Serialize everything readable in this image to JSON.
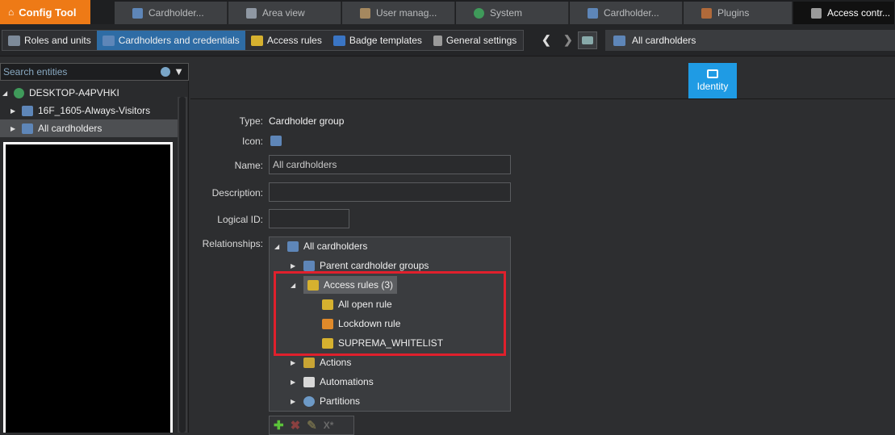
{
  "app": {
    "title": "Config Tool"
  },
  "tabs": [
    {
      "label": "Cardholder...",
      "icon": "cardholder-icon"
    },
    {
      "label": "Area view",
      "icon": "area-view-icon"
    },
    {
      "label": "User manag...",
      "icon": "user-management-icon"
    },
    {
      "label": "System",
      "icon": "system-icon"
    },
    {
      "label": "Cardholder...",
      "icon": "cardholder-icon"
    },
    {
      "label": "Plugins",
      "icon": "plugins-icon"
    },
    {
      "label": "Access contr...",
      "icon": "access-control-icon"
    }
  ],
  "toolbar": {
    "items": [
      {
        "label": "Roles and units"
      },
      {
        "label": "Cardholders and credentials"
      },
      {
        "label": "Access rules"
      },
      {
        "label": "Badge templates"
      },
      {
        "label": "General settings"
      }
    ]
  },
  "breadcrumb": {
    "label": "All cardholders"
  },
  "left": {
    "search_placeholder": "Search entities",
    "tree": [
      {
        "label": "DESKTOP-A4PVHKI"
      },
      {
        "label": "16F_1605-Always-Visitors"
      },
      {
        "label": "All cardholders"
      }
    ]
  },
  "identity_tab": {
    "label": "Identity"
  },
  "form": {
    "type_label": "Type:",
    "type_value": "Cardholder group",
    "icon_label": "Icon:",
    "name_label": "Name:",
    "name_value": "All cardholders",
    "description_label": "Description:",
    "description_value": "",
    "logical_id_label": "Logical ID:",
    "logical_id_value": "",
    "relationships_label": "Relationships:"
  },
  "relationships": {
    "root": "All cardholders",
    "parent_groups": "Parent cardholder groups",
    "access_rules": "Access rules (3)",
    "rules": [
      "All open rule",
      "Lockdown rule",
      "SUPREMA_WHITELIST"
    ],
    "actions": "Actions",
    "automations": "Automations",
    "partitions": "Partitions"
  },
  "colors": {
    "accent": "#ee7a16",
    "selected": "#2e6ca5",
    "identity": "#1f9be4",
    "highlight": "#e0202c"
  }
}
